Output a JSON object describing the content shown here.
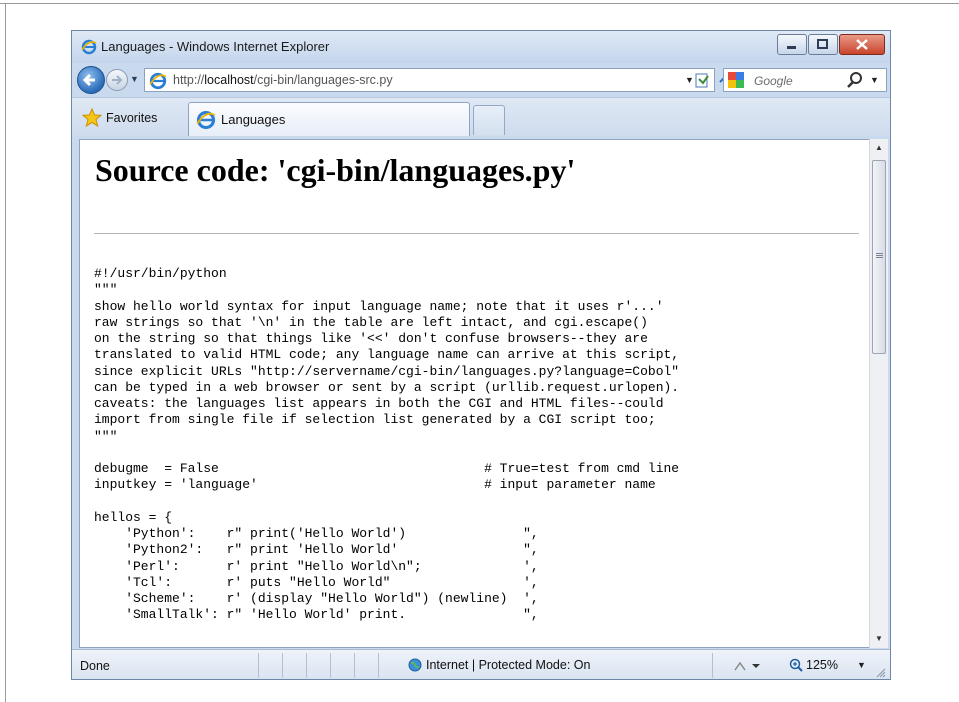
{
  "window": {
    "title": "Languages - Windows Internet Explorer"
  },
  "address": {
    "url_prefix": "http://",
    "url_host": "localhost",
    "url_path": "/cgi-bin/languages-src.py"
  },
  "search": {
    "placeholder": "Google"
  },
  "favorites_bar": {
    "favorites_label": "Favorites",
    "tab_label": "Languages"
  },
  "document": {
    "heading": "Source code: 'cgi-bin/languages.py'",
    "source": "#!/usr/bin/python\n\"\"\"\nshow hello world syntax for input language name; note that it uses r'...'\nraw strings so that '\\n' in the table are left intact, and cgi.escape()\non the string so that things like '<<' don't confuse browsers--they are\ntranslated to valid HTML code; any language name can arrive at this script,\nsince explicit URLs \"http://servername/cgi-bin/languages.py?language=Cobol\"\ncan be typed in a web browser or sent by a script (urllib.request.urlopen).\ncaveats: the languages list appears in both the CGI and HTML files--could\nimport from single file if selection list generated by a CGI script too;\n\"\"\"\n\ndebugme  = False                                  # True=test from cmd line\ninputkey = 'language'                             # input parameter name\n\nhellos = {\n    'Python':    r\" print('Hello World')               \",\n    'Python2':   r\" print 'Hello World'                \",\n    'Perl':      r' print \"Hello World\\n\";             ',\n    'Tcl':       r' puts \"Hello World\"                 ',\n    'Scheme':    r' (display \"Hello World\") (newline)  ',\n    'SmallTalk': r\" 'Hello World' print.               \","
  },
  "status": {
    "text": "Done",
    "zone": "Internet | Protected Mode: On",
    "zoom": "125%"
  },
  "colors": {
    "titlebar": "#c4d5ec",
    "close_button": "#c9442b",
    "accent_blue": "#2a6bb8"
  }
}
